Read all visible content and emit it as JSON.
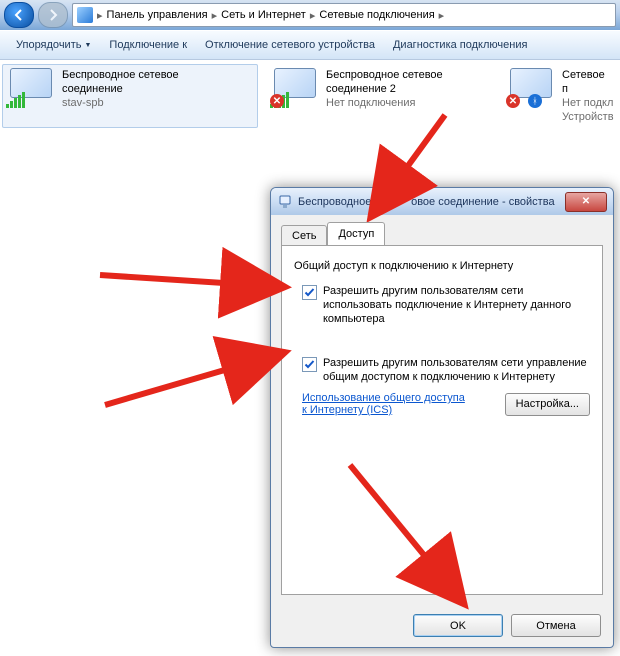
{
  "breadcrumbs": {
    "seg1": "Панель управления",
    "seg2": "Сеть и Интернет",
    "seg3": "Сетевые подключения"
  },
  "commands": {
    "organize": "Упорядочить",
    "connect_to": "Подключение к",
    "disable_device": "Отключение сетевого устройства",
    "diagnose": "Диагностика подключения"
  },
  "connections": [
    {
      "title": "Беспроводное сетевое",
      "title2": "соединение",
      "sub": "stav-spb"
    },
    {
      "title": "Беспроводное сетевое",
      "title2": "соединение 2",
      "sub": "Нет подключения"
    },
    {
      "title": "Сетевое п",
      "title2": "Нет подкл",
      "sub": "Устройств"
    }
  ],
  "dialog": {
    "title": "Беспроводное             овое соединение - свойства",
    "tabs": {
      "network": "Сеть",
      "sharing": "Доступ"
    },
    "group_title": "Общий доступ к подключению к Интернету",
    "chk1": "Разрешить другим пользователям сети использовать подключение к Интернету данного компьютера",
    "chk2": "Разрешить другим пользователям сети управление общим доступом к подключению к Интернету",
    "link": "Использование общего доступа к Интернету (ICS)",
    "settings_btn": "Настройка...",
    "ok": "OK",
    "cancel": "Отмена"
  }
}
